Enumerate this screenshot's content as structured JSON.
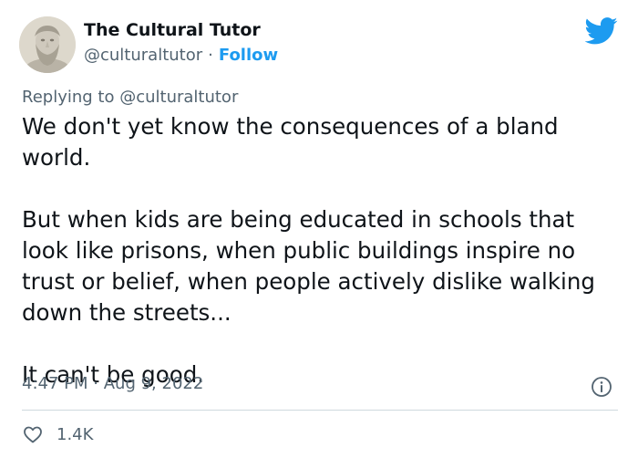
{
  "author": {
    "name": "The Cultural Tutor",
    "handle": "@culturaltutor",
    "separator": "·",
    "follow_label": "Follow"
  },
  "reply": {
    "prefix": "Replying to ",
    "mention": "@culturaltutor"
  },
  "tweet": {
    "text": "We don't yet know the consequences of a bland\nworld.\n\nBut when kids are being educated in schools that\nlook like prisons, when public buildings inspire no\ntrust or belief, when people actively dislike walking\ndown the streets...\n\nIt can't be good.",
    "time": "4:47 PM",
    "time_separator": "·",
    "date": "Aug 9, 2022"
  },
  "engagement": {
    "likes": "1.4K"
  },
  "icons": {
    "brand": "twitter-bird-icon",
    "info": "info-icon",
    "like": "heart-icon"
  },
  "colors": {
    "accent": "#1d9bf0",
    "text": "#0f1419",
    "secondary": "#536471",
    "divider": "#cfd9de"
  }
}
